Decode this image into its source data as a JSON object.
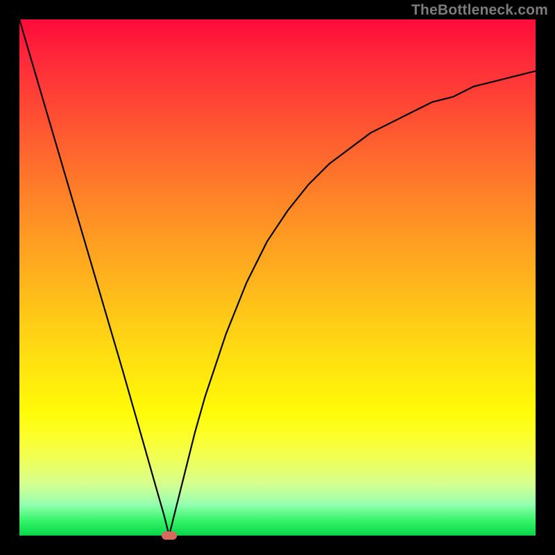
{
  "watermark": "TheBottleneck.com",
  "colors": {
    "frame": "#000000",
    "curve": "#000000",
    "marker": "#d56b5e"
  },
  "chart_data": {
    "type": "line",
    "title": "",
    "xlabel": "",
    "ylabel": "",
    "xlim": [
      0,
      100
    ],
    "ylim": [
      0,
      100
    ],
    "grid": false,
    "legend": false,
    "annotations": [
      "TheBottleneck.com"
    ],
    "series": [
      {
        "name": "bottleneck-curve",
        "x": [
          0,
          5,
          10,
          15,
          20,
          24,
          26,
          28,
          29,
          30,
          32,
          34,
          36,
          38,
          40,
          44,
          48,
          52,
          56,
          60,
          64,
          68,
          72,
          76,
          80,
          84,
          88,
          92,
          96,
          100
        ],
        "values": [
          100,
          83,
          66,
          49,
          32,
          18,
          11,
          4,
          0,
          4,
          12,
          20,
          27,
          33,
          39,
          49,
          57,
          63,
          68,
          72,
          75,
          78,
          80,
          82,
          84,
          85,
          87,
          88,
          89,
          90
        ]
      }
    ],
    "marker": {
      "x": 29,
      "y": 0
    }
  }
}
